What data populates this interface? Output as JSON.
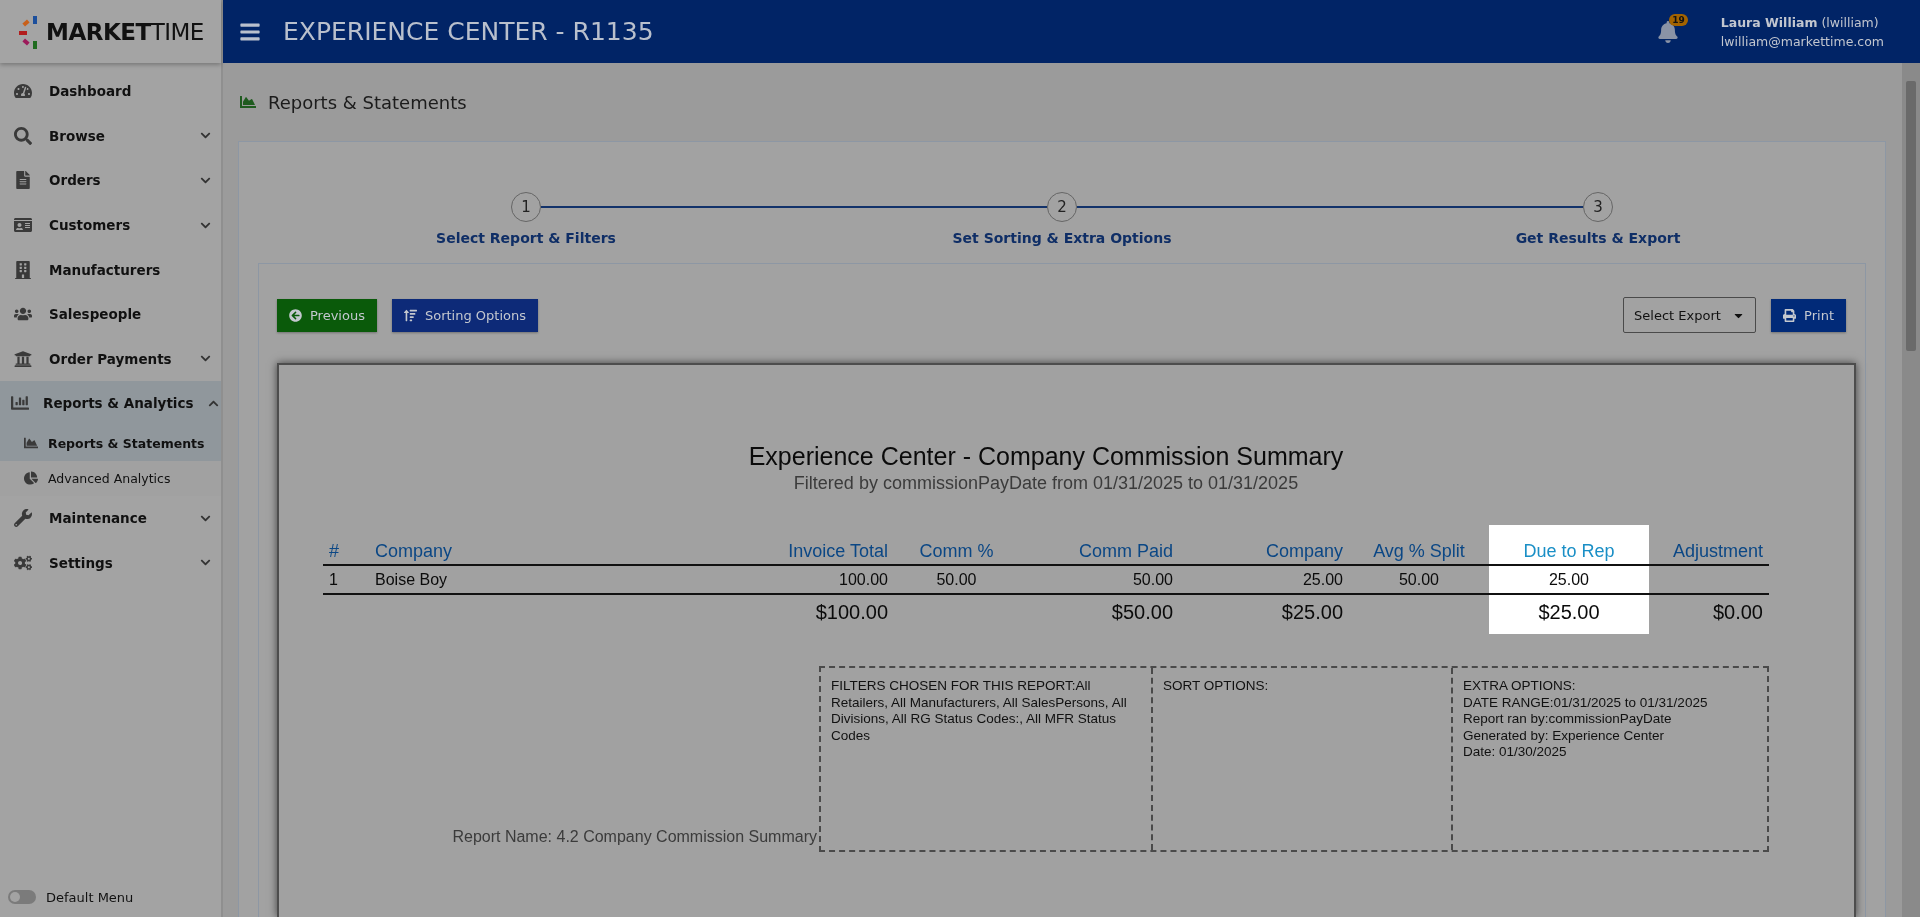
{
  "brand": {
    "logo_bold": "MARKET",
    "logo_light": "TIME"
  },
  "header": {
    "title": "EXPERIENCE CENTER - R1135",
    "notification_count": "19",
    "user_name": "Laura William",
    "user_login": "(lwilliam)",
    "user_email": "lwilliam@markettime.com"
  },
  "sidebar": {
    "items": [
      {
        "label": "Dashboard",
        "selected": false
      },
      {
        "label": "Browse",
        "selected": false,
        "expanded": false
      },
      {
        "label": "Orders",
        "selected": false,
        "expanded": false
      },
      {
        "label": "Customers",
        "selected": false,
        "expanded": false
      },
      {
        "label": "Manufacturers",
        "selected": false
      },
      {
        "label": "Salespeople",
        "selected": false
      },
      {
        "label": "Order Payments",
        "selected": false,
        "expanded": false
      },
      {
        "label": "Reports & Analytics",
        "selected": true,
        "expanded": true,
        "children": [
          {
            "label": "Reports & Statements",
            "selected": true
          },
          {
            "label": "Advanced Analytics",
            "selected": false
          }
        ]
      },
      {
        "label": "Maintenance",
        "selected": false,
        "expanded": false
      },
      {
        "label": "Settings",
        "selected": false,
        "expanded": false
      }
    ],
    "default_menu": {
      "label": "Default Menu",
      "on": false
    }
  },
  "page_title": "Reports & Statements",
  "steps": [
    {
      "number": "1",
      "label": "Select Report & Filters"
    },
    {
      "number": "2",
      "label": "Set Sorting & Extra Options"
    },
    {
      "number": "3",
      "label": "Get Results & Export"
    }
  ],
  "toolbar": {
    "previous": "Previous",
    "sorting": "Sorting Options",
    "export": {
      "value": "Select Export"
    },
    "print": "Print"
  },
  "report": {
    "title": "Experience Center - Company Commission Summary",
    "subtitle": "Filtered by commissionPayDate from 01/31/2025 to 01/31/2025",
    "columns": [
      {
        "label": "#",
        "highlighted": false
      },
      {
        "label": "Company",
        "highlighted": false
      },
      {
        "label": "Invoice Total",
        "highlighted": false
      },
      {
        "label": "Comm %",
        "highlighted": false
      },
      {
        "label": "Comm Paid",
        "highlighted": false
      },
      {
        "label": "Company",
        "highlighted": false
      },
      {
        "label": "Avg % Split",
        "highlighted": false
      },
      {
        "label": "Due to Rep",
        "highlighted": true
      },
      {
        "label": "Adjustment",
        "highlighted": false
      }
    ],
    "rows": [
      {
        "number": "1",
        "company": "Boise Boy",
        "invoice_total": "100.00",
        "comm_percent": "50.00",
        "comm_paid": "50.00",
        "company_amount": "25.00",
        "avg_split": "50.00",
        "due_to_rep": "25.00"
      }
    ],
    "totals": {
      "invoice_total": "$100.00",
      "comm_paid": "$50.00",
      "company_amount": "$25.00",
      "due_to_rep": "$25.00",
      "adjustment": "$0.00"
    },
    "report_name": "Report Name: 4.2 Company Commission Summary",
    "filters": "FILTERS CHOSEN FOR THIS REPORT:All Retailers, All Manufacturers, All SalesPersons, All Divisions, All RG Status Codes:, All MFR Status Codes",
    "sort_options": "SORT OPTIONS:",
    "extra_options": [
      "EXTRA OPTIONS:",
      "DATE RANGE:01/31/2025 to 01/31/2025",
      "Report ran by:commissionPayDate",
      "Generated by: Experience Center",
      "Date: 01/30/2025"
    ]
  }
}
